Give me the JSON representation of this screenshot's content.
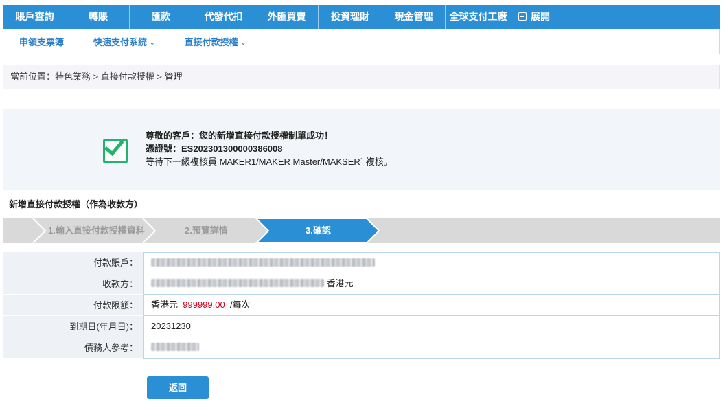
{
  "top_nav": {
    "items": [
      "賬戶查詢",
      "轉賬",
      "匯款",
      "代發代扣",
      "外匯買賣",
      "投資理財",
      "現金管理",
      "全球支付工廠"
    ],
    "expand_label": "展開"
  },
  "sub_nav": {
    "items": [
      "申領支票簿",
      "快速支付系統",
      "直接付款授權"
    ]
  },
  "breadcrumb": {
    "prefix": "當前位置：特色業務 > 直接付款授權 > ",
    "current": "管理"
  },
  "success": {
    "line1": "尊敬的客戶：您的新增直接付款授權制單成功！",
    "voucher_label": "憑證號：",
    "voucher_no": "ES202301300000386008",
    "line3": "等待下一級複核員 MAKER1/MAKER Master/MAKSER` 複核。"
  },
  "section_title": "新增直接付款授權（作為收款方）",
  "steps": {
    "labels": [
      "1.輸入直接付款授權資料",
      "2.預覽詳情",
      "3.確認"
    ],
    "active_index": 2
  },
  "details": {
    "payer_account_label": "付款賬戶：",
    "payee_label": "收款方：",
    "payee_currency": "香港元",
    "limit_label": "付款限額：",
    "limit_currency": "香港元",
    "limit_amount": "999999.00",
    "limit_unit": "/每次",
    "expiry_label": "到期日(年月日)：",
    "expiry_value": "20231230",
    "debtor_ref_label": "債務人參考："
  },
  "buttons": {
    "back": "返回"
  },
  "colors": {
    "primary": "#2b8fd6",
    "success_green": "#24b36b",
    "amount_red": "#d0021b"
  }
}
